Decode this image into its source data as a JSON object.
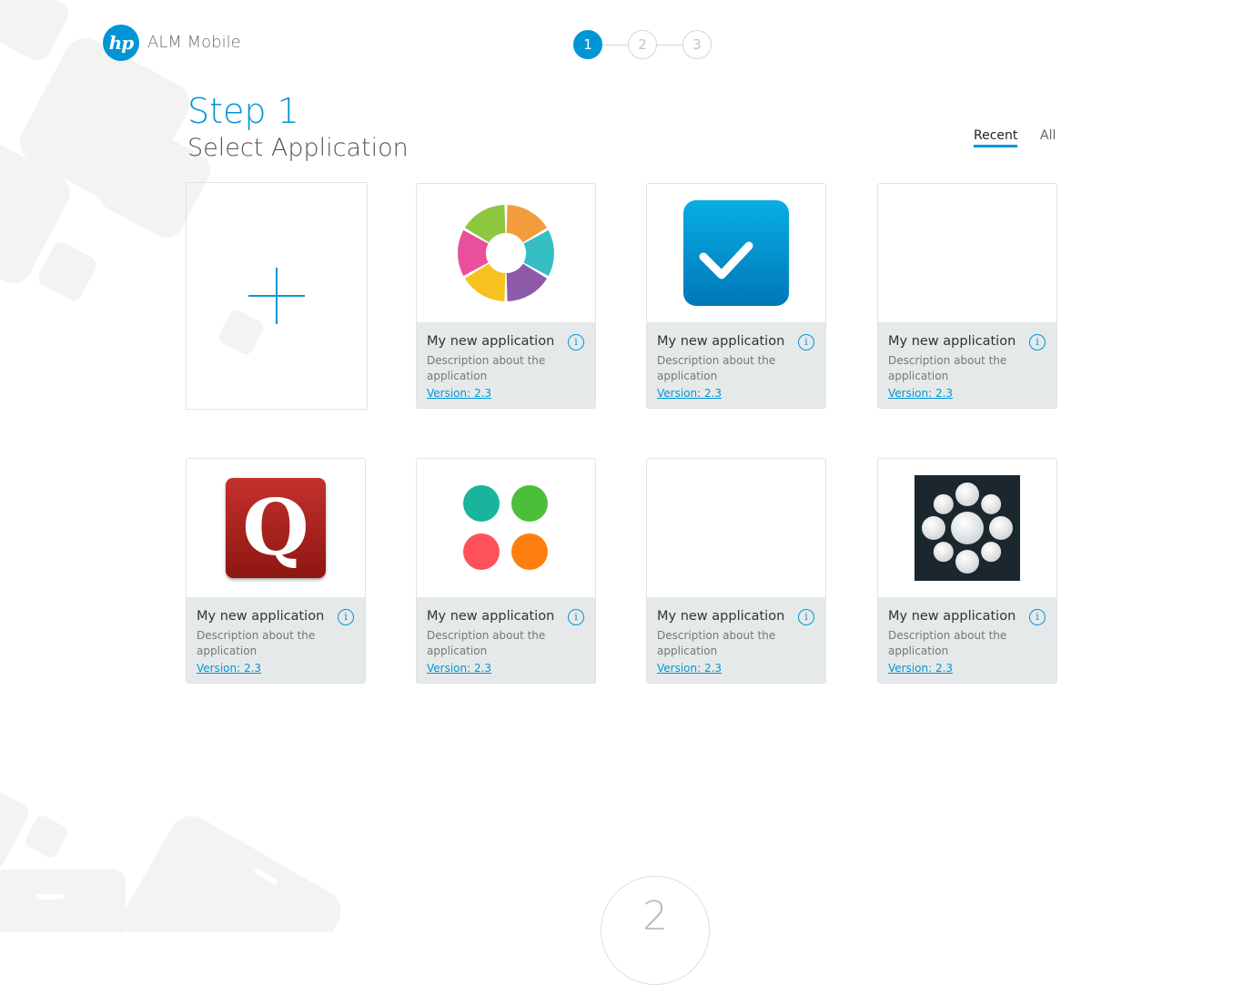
{
  "header": {
    "logo_text": "hp",
    "app_name": "ALM Mobile",
    "steps": [
      "1",
      "2",
      "3"
    ],
    "active_step": 1
  },
  "page": {
    "step_title": "Step 1",
    "subtitle": "Select Application"
  },
  "filters": {
    "recent": "Recent",
    "all": "All",
    "selected": "Recent"
  },
  "add_card": {
    "icon": "plus-icon"
  },
  "apps": [
    {
      "name": "My new application",
      "description": "Description about the application",
      "version": "Version: 2.3",
      "icon": "donut-icon"
    },
    {
      "name": "My new application",
      "description": "Description about the application",
      "version": "Version: 2.3",
      "icon": "checkmark-icon"
    },
    {
      "name": "My new application",
      "description": "Description about the application",
      "version": "Version: 2.3",
      "icon": "none"
    },
    {
      "name": "My new application",
      "description": "Description about the application",
      "version": "Version: 2.3",
      "icon": "q-icon"
    },
    {
      "name": "My new application",
      "description": "Description about the application",
      "version": "Version: 2.3",
      "icon": "four-dots-icon"
    },
    {
      "name": "My new application",
      "description": "Description about the application",
      "version": "Version: 2.3",
      "icon": "none"
    },
    {
      "name": "My new application",
      "description": "Description about the application",
      "version": "Version: 2.3",
      "icon": "dot-ring-icon"
    }
  ],
  "q_letter": "Q",
  "info_glyph": "i",
  "next_step_indicator": "2",
  "colors": {
    "accent": "#0096d6",
    "card_footer": "#e6e9e9",
    "donut": [
      "#f39c3d",
      "#36bec5",
      "#8d5aa8",
      "#f5c21e",
      "#ea4f9b",
      "#8dc63f"
    ],
    "dots": [
      "#1ab39c",
      "#4cbf3a",
      "#ff5159",
      "#ff7f0e"
    ]
  }
}
